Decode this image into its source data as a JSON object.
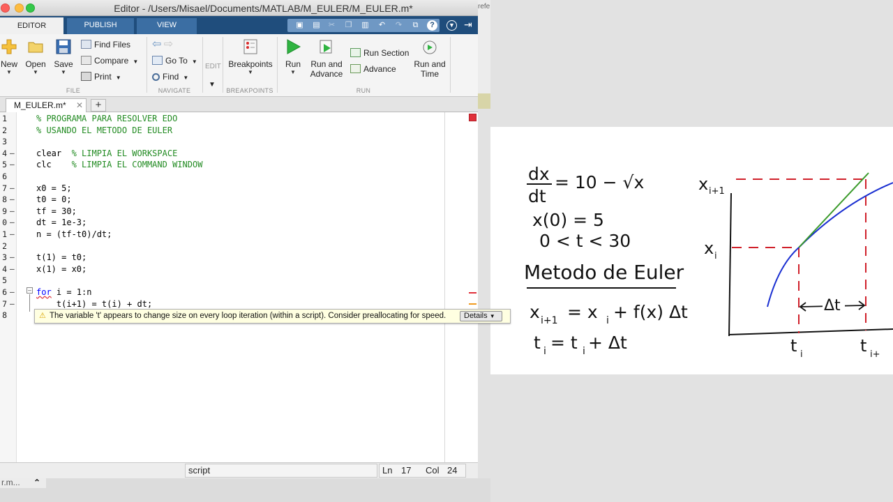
{
  "window": {
    "title": "Editor - /Users/Misael/Documents/MATLAB/M_EULER/M_EULER.m*"
  },
  "ribbon_tabs": [
    "EDITOR",
    "PUBLISH",
    "VIEW"
  ],
  "ribbon": {
    "file": {
      "new": "New",
      "open": "Open",
      "save": "Save",
      "find_files": "Find Files",
      "compare": "Compare",
      "print": "Print",
      "group": "FILE"
    },
    "navigate": {
      "go_to": "Go To",
      "find": "Find",
      "group": "NAVIGATE"
    },
    "edit": {
      "label": "EDIT"
    },
    "breakpoints": {
      "label": "Breakpoints",
      "group": "BREAKPOINTS"
    },
    "run": {
      "run": "Run",
      "run_and_advance_1": "Run and",
      "run_and_advance_2": "Advance",
      "run_section": "Run Section",
      "advance": "Advance",
      "run_and_time_1": "Run and",
      "run_and_time_2": "Time",
      "group": "RUN"
    }
  },
  "document_tab": {
    "name": "M_EULER.m*",
    "close": "✕",
    "add": "+"
  },
  "code": {
    "line_numbers": [
      "1",
      "2",
      "3",
      "4",
      "5",
      "6",
      "7",
      "8",
      "9",
      "0",
      "1",
      "2",
      "3",
      "4",
      "5",
      "6",
      "7",
      "8"
    ],
    "breakpoint_marks": [
      "",
      "",
      "",
      "–",
      "–",
      "",
      "–",
      "–",
      "–",
      "–",
      "–",
      "",
      "–",
      "–",
      "",
      "–",
      "–",
      ""
    ],
    "lines": [
      {
        "comment": "% PROGRAMA PARA RESOLVER EDO"
      },
      {
        "comment": "% USANDO EL METODO DE EULER"
      },
      {},
      {
        "code": "clear  ",
        "comment": "% LIMPIA EL WORKSPACE"
      },
      {
        "code": "clc    ",
        "comment": "% LIMPIA EL COMMAND WINDOW"
      },
      {},
      {
        "code": "x0 = 5;"
      },
      {
        "code": "t0 = 0;"
      },
      {
        "code": "tf = 30;"
      },
      {
        "code": "dt = 1e-3;"
      },
      {
        "code": "n = (tf-t0)/dt;"
      },
      {},
      {
        "code": "t(1) = t0;"
      },
      {
        "code": "x(1) = x0;"
      },
      {},
      {
        "keyword": "for",
        "code": " i = 1:n"
      },
      {
        "code": "    t(i+1) = t(i) + dt;"
      },
      {}
    ]
  },
  "tooltip": {
    "message": "The variable 't' appears to change size on every loop iteration (within a script). Consider preallocating for speed.",
    "details": "Details"
  },
  "status": {
    "mode": "script",
    "ln_label": "Ln",
    "ln": "17",
    "col_label": "Col",
    "col": "24"
  },
  "background": {
    "strip_text": "refe\nat P\nara\nVIRO",
    "mini_tab": "r.m..."
  },
  "whiteboard": {
    "eq1_num": "dx",
    "eq1_den": "dt",
    "eq1_rhs": "= 10 − √x",
    "eq2": "x(0) = 5",
    "eq3": "0 < t < 30",
    "heading": "Metodo de Euler",
    "eq4_lhs": "x",
    "eq4_lhs_sub": "i+1",
    "eq4_mid": "=   x",
    "eq4_mid_sub": "i",
    "eq4_rhs": " +  f(x) Δt",
    "eq5": "t",
    "eq5_sub": "i",
    "eq5_rhs": " = t",
    "eq5_rhs_sub": "i",
    "eq5_tail": " + Δt",
    "graph_y_top": "x",
    "graph_y_top_sub": "i+1",
    "graph_y_mid": "x",
    "graph_y_mid_sub": "i",
    "graph_dt": "Δt",
    "graph_x1": "t",
    "graph_x1_sub": "i",
    "graph_x2": "t",
    "graph_x2_sub": "i+"
  },
  "colors": {
    "ribbon_blue": "#1f4d7c",
    "comment_green": "#228b22",
    "keyword_blue": "#0000ff",
    "dash_red": "#d0202a",
    "curve_blue": "#1a2fd1",
    "tangent_green": "#3a9a2a"
  }
}
